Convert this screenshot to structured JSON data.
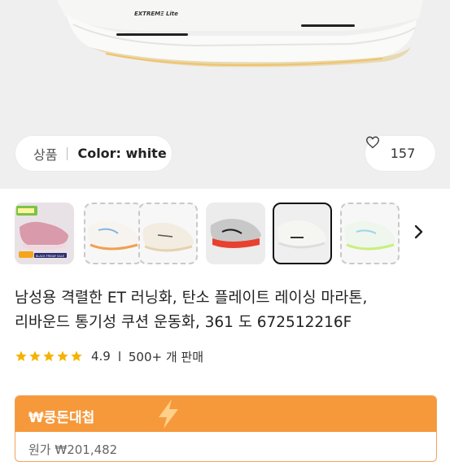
{
  "hero": {
    "shoe_brand_text": "EXTREMΞ Lite",
    "category": "상품",
    "color_label": "Color: white",
    "likes": "157"
  },
  "thumbnails": [
    {
      "name": "pink-sneaker",
      "badge_text": "BLACK FRIDAY SALE",
      "dashed": false,
      "selected": false
    },
    {
      "name": "white-orange-sneaker",
      "dashed": true,
      "selected": false
    },
    {
      "name": "cream-sneaker",
      "dashed": true,
      "selected": false
    },
    {
      "name": "red-silver-sneaker",
      "dashed": false,
      "selected": false
    },
    {
      "name": "white-sneaker",
      "dashed": false,
      "selected": true
    },
    {
      "name": "mint-sneaker",
      "dashed": true,
      "selected": false
    }
  ],
  "product": {
    "title_line1": "남성용 격렬한 ET 러닝화, 탄소 플레이트 레이싱 마라톤,",
    "title_line2": "리바운드 통기성 쿠션 운동화, 361 도 672512216F",
    "rating": "4.9",
    "stars": 5,
    "sold": "500+ 개 판매"
  },
  "deal": {
    "title": "₩쿵돈대첩",
    "original_price": "원가 ₩201,482"
  },
  "colors": {
    "star": "#f5b301",
    "deal_orange": "#f6993b"
  }
}
